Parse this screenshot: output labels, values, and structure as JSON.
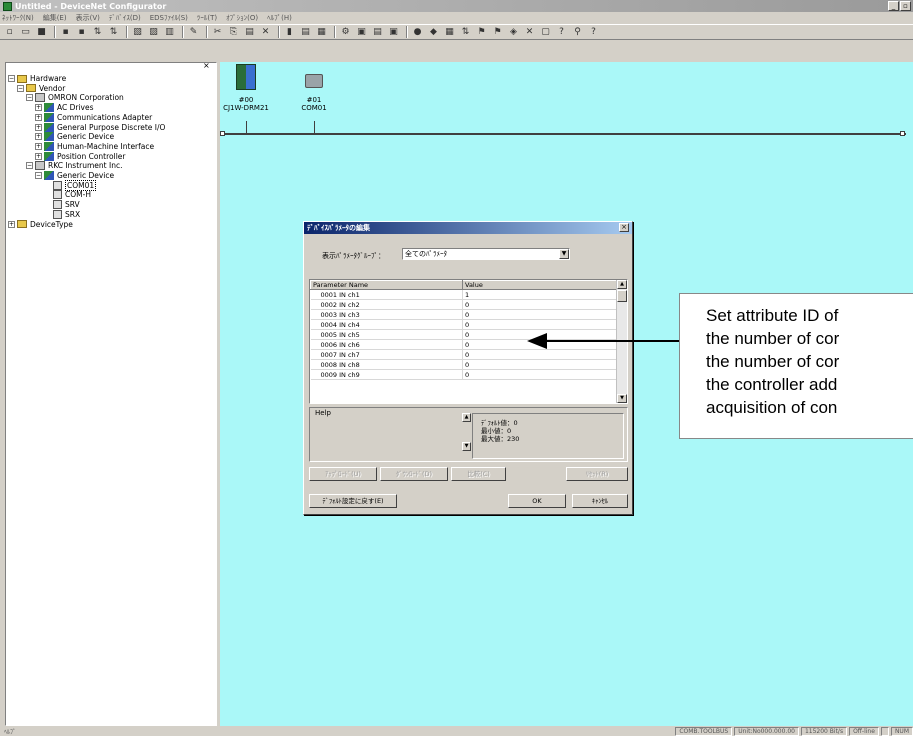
{
  "window": {
    "title": "Untitled - DeviceNet Configurator"
  },
  "menubar": {
    "items": [
      "ﾈｯﾄﾜｰｸ(N)",
      "編集(E)",
      "表示(V)",
      "ﾃﾞﾊﾞｲｽ(D)",
      "EDSﾌｧｲﾙ(S)",
      "ﾂｰﾙ(T)",
      "ｵﾌﾟｼｮﾝ(O)",
      "ﾍﾙﾌﾟ(H)"
    ]
  },
  "toolbar": {
    "icons": [
      "new-icon",
      "open-icon",
      "save-icon",
      "connect-icon",
      "disconnect-icon",
      "upload-icon",
      "download-icon",
      "monitor-icon",
      "parameter-icon",
      "edit-icon",
      "print-icon",
      "cut-icon",
      "copy-icon",
      "paste-icon",
      "delete-icon",
      "properties-icon",
      "register-icon",
      "grid-icon",
      "tool-icon",
      "record-icon",
      "master-icon",
      "slave-icon",
      "dot-icon",
      "arrow-icon",
      "table-icon",
      "diagnose-icon",
      "upload2-icon",
      "download2-icon",
      "wizard-icon",
      "close2-icon",
      "info-icon",
      "help-icon",
      "search-icon",
      "about-icon"
    ],
    "glyphs": [
      "▫",
      "▭",
      "■",
      "▪",
      "▪",
      "⇅",
      "⇅",
      "▧",
      "▨",
      "▥",
      "✎",
      "✂",
      "⎘",
      "▤",
      "✕",
      "▮",
      "▤",
      "▦",
      "⚙",
      "▣",
      "▤",
      "▣",
      "●",
      "◆",
      "▦",
      "⇅",
      "⚑",
      "⚑",
      "◈",
      "✕",
      "▢",
      "?",
      "⚲",
      "?"
    ]
  },
  "tree": {
    "close": "×",
    "items": [
      {
        "label": "Hardware",
        "level": 0,
        "exp": "−",
        "icon": "folder"
      },
      {
        "label": "Vendor",
        "level": 1,
        "exp": "−",
        "icon": "folder"
      },
      {
        "label": "OMRON Corporation",
        "level": 2,
        "exp": "−",
        "icon": "vendor"
      },
      {
        "label": "AC Drives",
        "level": 3,
        "exp": "+",
        "icon": "dev"
      },
      {
        "label": "Communications Adapter",
        "level": 3,
        "exp": "+",
        "icon": "dev"
      },
      {
        "label": "General Purpose Discrete I/O",
        "level": 3,
        "exp": "+",
        "icon": "dev"
      },
      {
        "label": "Generic Device",
        "level": 3,
        "exp": "+",
        "icon": "dev"
      },
      {
        "label": "Human-Machine Interface",
        "level": 3,
        "exp": "+",
        "icon": "dev"
      },
      {
        "label": "Position Controller",
        "level": 3,
        "exp": "+",
        "icon": "dev"
      },
      {
        "label": "RKC Instrument Inc.",
        "level": 2,
        "exp": "−",
        "icon": "vendor"
      },
      {
        "label": "Generic Device",
        "level": 3,
        "exp": "−",
        "icon": "dev"
      },
      {
        "label": "COM01",
        "level": 4,
        "exp": "",
        "icon": "eds",
        "selected": true
      },
      {
        "label": "COM-H",
        "level": 4,
        "exp": "",
        "icon": "eds"
      },
      {
        "label": "SRV",
        "level": 4,
        "exp": "",
        "icon": "eds"
      },
      {
        "label": "SRX",
        "level": 4,
        "exp": "",
        "icon": "eds"
      },
      {
        "label": "DeviceType",
        "level": 0,
        "exp": "+",
        "icon": "folder"
      }
    ]
  },
  "network": {
    "nodes": [
      {
        "address": "#00",
        "name": "CJ1W-DRM21",
        "icon": "master-unit-icon"
      },
      {
        "address": "#01",
        "name": "COM01",
        "icon": "slave-device-icon"
      }
    ]
  },
  "dialog": {
    "title": "ﾃﾞﾊﾞｲｽﾊﾟﾗﾒｰﾀの編集",
    "close": "×",
    "group_label": "表示ﾊﾟﾗﾒｰﾀｸﾞﾙｰﾌﾟ：",
    "group_value": "全てのﾊﾟﾗﾒｰﾀ",
    "dropdown_glyph": "▼",
    "columns": [
      "Parameter Name",
      "Value"
    ],
    "rows": [
      {
        "name": "0001 IN ch1",
        "value": "1"
      },
      {
        "name": "0002 IN ch2",
        "value": "0"
      },
      {
        "name": "0003 IN ch3",
        "value": "0"
      },
      {
        "name": "0004 IN ch4",
        "value": "0"
      },
      {
        "name": "0005 IN ch5",
        "value": "0"
      },
      {
        "name": "0006 IN ch6",
        "value": "0"
      },
      {
        "name": "0007 IN ch7",
        "value": "0"
      },
      {
        "name": "0008 IN ch8",
        "value": "0"
      },
      {
        "name": "0009 IN ch9",
        "value": "0"
      }
    ],
    "scroll_up": "▲",
    "scroll_down": "▼",
    "help_label": "Help",
    "help_default": "ﾃﾞﾌｫﾙﾄ値：0",
    "help_min": "最小値：0",
    "help_max": "最大値：230",
    "btn_upload": "ｱｯﾌﾟﾛｰﾄﾞ(U)",
    "btn_download": "ﾀﾞｳﾝﾛｰﾄﾞ(D)",
    "btn_compare": "比較(C)",
    "btn_reset": "ﾘｾｯﾄ(R)",
    "btn_default": "ﾃﾞﾌｫﾙﾄ設定に戻す(E)",
    "btn_ok": "OK",
    "btn_cancel": "ｷｬﾝｾﾙ"
  },
  "callout": {
    "lines": [
      "Set attribute ID of",
      "the number of cor",
      "the number of cor",
      "the controller add",
      "acquisition of con"
    ]
  },
  "statusbar": {
    "left": "ﾍﾙﾌﾟ",
    "cells": [
      "COMB.TOOLBUS",
      "Unit:No000.000.00",
      "115200 Bit/s",
      "Off-line",
      "",
      "NUM"
    ]
  }
}
